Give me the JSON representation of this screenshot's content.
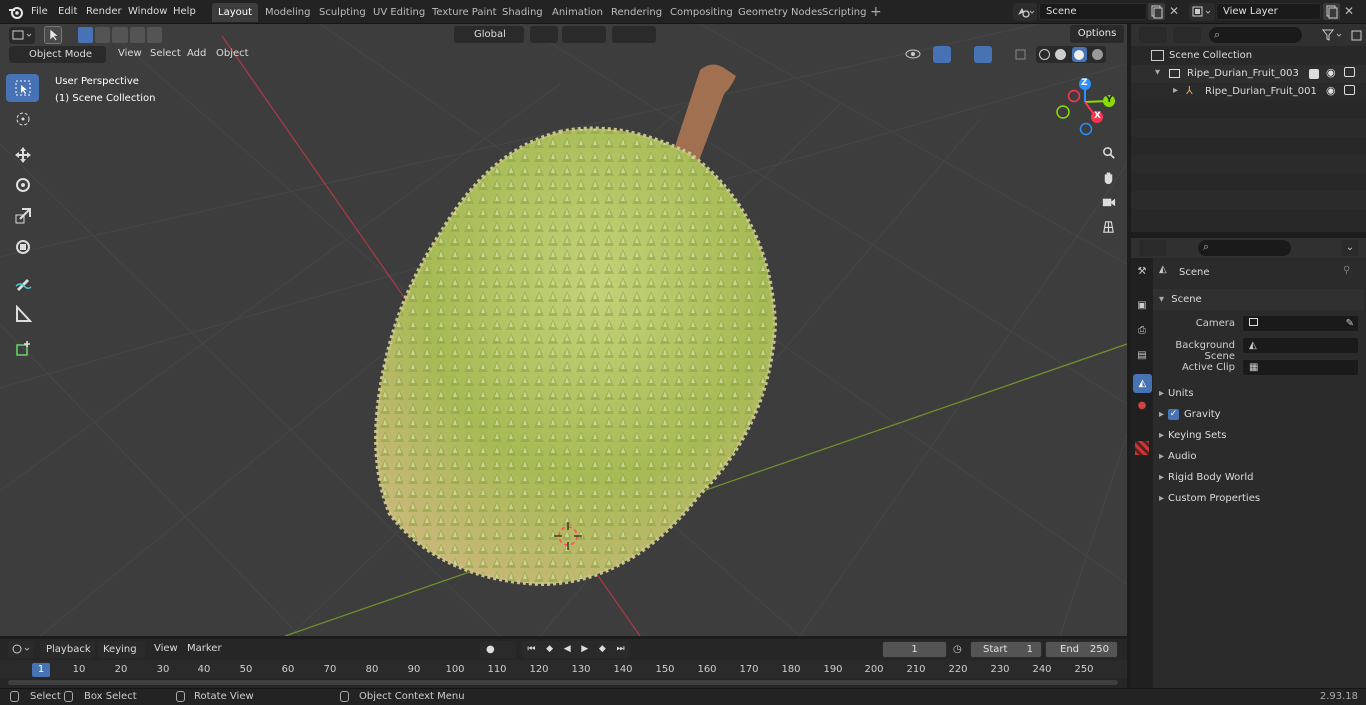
{
  "app": {
    "version": "2.93.18"
  },
  "menu": [
    "File",
    "Edit",
    "Render",
    "Window",
    "Help"
  ],
  "workspaces": [
    "Layout",
    "Modeling",
    "Sculpting",
    "UV Editing",
    "Texture Paint",
    "Shading",
    "Animation",
    "Rendering",
    "Compositing",
    "Geometry Nodes",
    "Scripting"
  ],
  "active_workspace": "Layout",
  "scene_field": "Scene",
  "view_layer_field": "View Layer",
  "viewport": {
    "mode": "Object Mode",
    "menus": [
      "View",
      "Select",
      "Add",
      "Object"
    ],
    "orientation": "Global",
    "options_label": "Options",
    "overlay_title": "User Perspective",
    "overlay_collection": "(1) Scene Collection",
    "gizmo_axes": {
      "x": "X",
      "y": "Y",
      "z": "Z"
    }
  },
  "outliner": {
    "root": "Scene Collection",
    "items": [
      "Ripe_Durian_Fruit_003",
      "Ripe_Durian_Fruit_001"
    ]
  },
  "properties": {
    "context": "Scene",
    "section": "Scene",
    "camera_label": "Camera",
    "background_scene_label": "Background Scene",
    "active_clip_label": "Active Clip",
    "subpanels": [
      "Units",
      "Gravity",
      "Keying Sets",
      "Audio",
      "Rigid Body World",
      "Custom Properties"
    ],
    "gravity_enabled": true
  },
  "timeline": {
    "menus": [
      "Playback",
      "Keying",
      "View",
      "Marker"
    ],
    "current_frame": "1",
    "start_label": "Start",
    "start_value": "1",
    "end_label": "End",
    "end_value": "250",
    "ruler": [
      "1",
      "10",
      "20",
      "30",
      "40",
      "50",
      "60",
      "70",
      "80",
      "90",
      "100",
      "110",
      "120",
      "130",
      "140",
      "150",
      "160",
      "170",
      "180",
      "190",
      "200",
      "210",
      "220",
      "230",
      "240",
      "250"
    ]
  },
  "statusbar": {
    "select": "Select",
    "box_select": "Box Select",
    "rotate_view": "Rotate View",
    "context_menu": "Object Context Menu"
  },
  "colors": {
    "accent": "#4772b3",
    "x_axis": "#ff3352",
    "y_axis": "#8bdc00",
    "z_axis": "#2890ff",
    "fruit": "#a9bd58"
  }
}
